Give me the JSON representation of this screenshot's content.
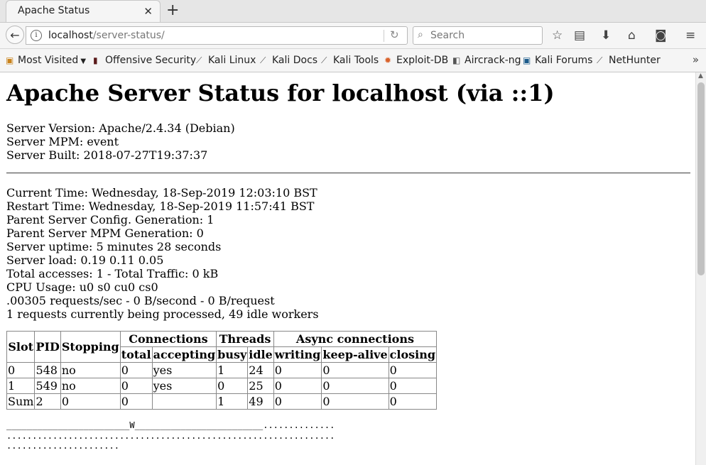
{
  "browser": {
    "tab_title": "Apache Status",
    "url_host": "localhost",
    "url_path": "/server-status/",
    "search_placeholder": "Search"
  },
  "bookmarks": [
    {
      "label": "Most Visited",
      "icon": "folder-icon"
    },
    {
      "label": "Offensive Security",
      "icon": "offsec-icon"
    },
    {
      "label": "Kali Linux",
      "icon": "kali-dragon-icon"
    },
    {
      "label": "Kali Docs",
      "icon": "kali-dragon-icon"
    },
    {
      "label": "Kali Tools",
      "icon": "kali-dragon-icon"
    },
    {
      "label": "Exploit-DB",
      "icon": "exploitdb-icon"
    },
    {
      "label": "Aircrack-ng",
      "icon": "aircrack-icon"
    },
    {
      "label": "Kali Forums",
      "icon": "kali-forums-icon"
    },
    {
      "label": "NetHunter",
      "icon": "kali-dragon-icon"
    }
  ],
  "page": {
    "title": "Apache Server Status for localhost (via ::1)",
    "server_version": "Server Version: Apache/2.4.34 (Debian)",
    "server_mpm": "Server MPM: event",
    "server_built": "Server Built: 2018-07-27T19:37:37",
    "current_time": "Current Time: Wednesday, 18-Sep-2019 12:03:10 BST",
    "restart_time": "Restart Time: Wednesday, 18-Sep-2019 11:57:41 BST",
    "parent_config_gen": "Parent Server Config. Generation: 1",
    "parent_mpm_gen": "Parent Server MPM Generation: 0",
    "uptime": "Server uptime: 5 minutes 28 seconds",
    "load": "Server load: 0.19 0.11 0.05",
    "accesses": "Total accesses: 1 - Total Traffic: 0 kB",
    "cpu": "CPU Usage: u0 s0 cu0 cs0",
    "rates": ".00305 requests/sec - 0 B/second - 0 B/request",
    "workers": "1 requests currently being processed, 49 idle workers"
  },
  "table": {
    "group_headers": {
      "slot": "Slot",
      "pid": "PID",
      "stopping": "Stopping",
      "connections": "Connections",
      "threads": "Threads",
      "async": "Async connections"
    },
    "sub_headers": [
      "total",
      "accepting",
      "busy",
      "idle",
      "writing",
      "keep-alive",
      "closing"
    ],
    "rows": [
      [
        "0",
        "548",
        "no",
        "0",
        "yes",
        "1",
        "24",
        "0",
        "0",
        "0"
      ],
      [
        "1",
        "549",
        "no",
        "0",
        "yes",
        "0",
        "25",
        "0",
        "0",
        "0"
      ],
      [
        "Sum",
        "2",
        "0",
        "0",
        "",
        "1",
        "49",
        "0",
        "0",
        "0"
      ]
    ]
  },
  "scoreboard": {
    "line1": "________________________W_________________________..............",
    "line2": "................................................................",
    "line3": "......................"
  }
}
